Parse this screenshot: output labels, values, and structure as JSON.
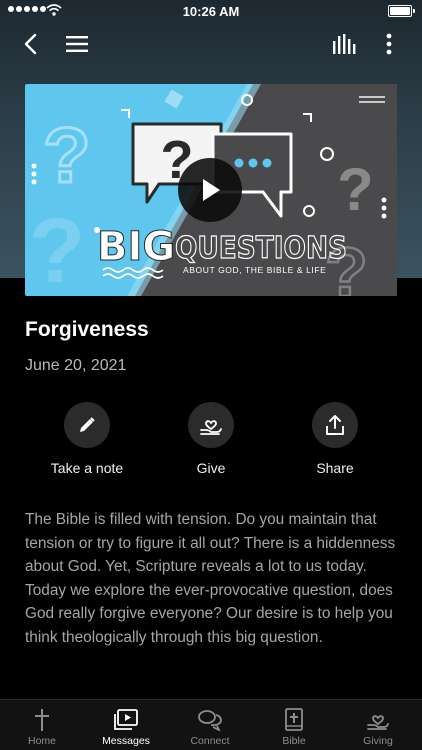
{
  "status_bar": {
    "time": "10:26 AM"
  },
  "nav": {
    "back_icon": "chevron-left-icon",
    "menu_icon": "hamburger-menu-icon",
    "audio_icon": "audio-bars-icon",
    "more_icon": "more-vertical-icon"
  },
  "video": {
    "headline_big": "BIG",
    "headline_questions": "QUESTIONS",
    "tagline": "ABOUT GOD, THE BIBLE & LIFE"
  },
  "message": {
    "title": "Forgiveness",
    "date": "June 20, 2021",
    "description": "The Bible is filled with tension. Do you maintain that tension or try to figure it all out? There is a hiddenness about God. Yet, Scripture reveals a lot to us today. Today we explore the ever-provocative question, does God really forgive everyone? Our desire is to help you think theologically through this big question."
  },
  "actions": [
    {
      "label": "Take a note",
      "icon": "pencil-icon"
    },
    {
      "label": "Give",
      "icon": "heart-hand-icon"
    },
    {
      "label": "Share",
      "icon": "share-icon"
    }
  ],
  "tabs": [
    {
      "label": "Home",
      "icon": "cross-icon"
    },
    {
      "label": "Messages",
      "icon": "video-library-icon"
    },
    {
      "label": "Connect",
      "icon": "chat-bubbles-icon"
    },
    {
      "label": "Bible",
      "icon": "bible-icon"
    },
    {
      "label": "Giving",
      "icon": "heart-hand-icon"
    }
  ],
  "colors": {
    "accent_blue": "#5fc6ee",
    "background": "#000000",
    "header_gradient_top": "#1e2830",
    "header_gradient_bottom": "#3b5360",
    "active_tab": "#ffffff",
    "inactive_tab": "#8d8d8d"
  }
}
